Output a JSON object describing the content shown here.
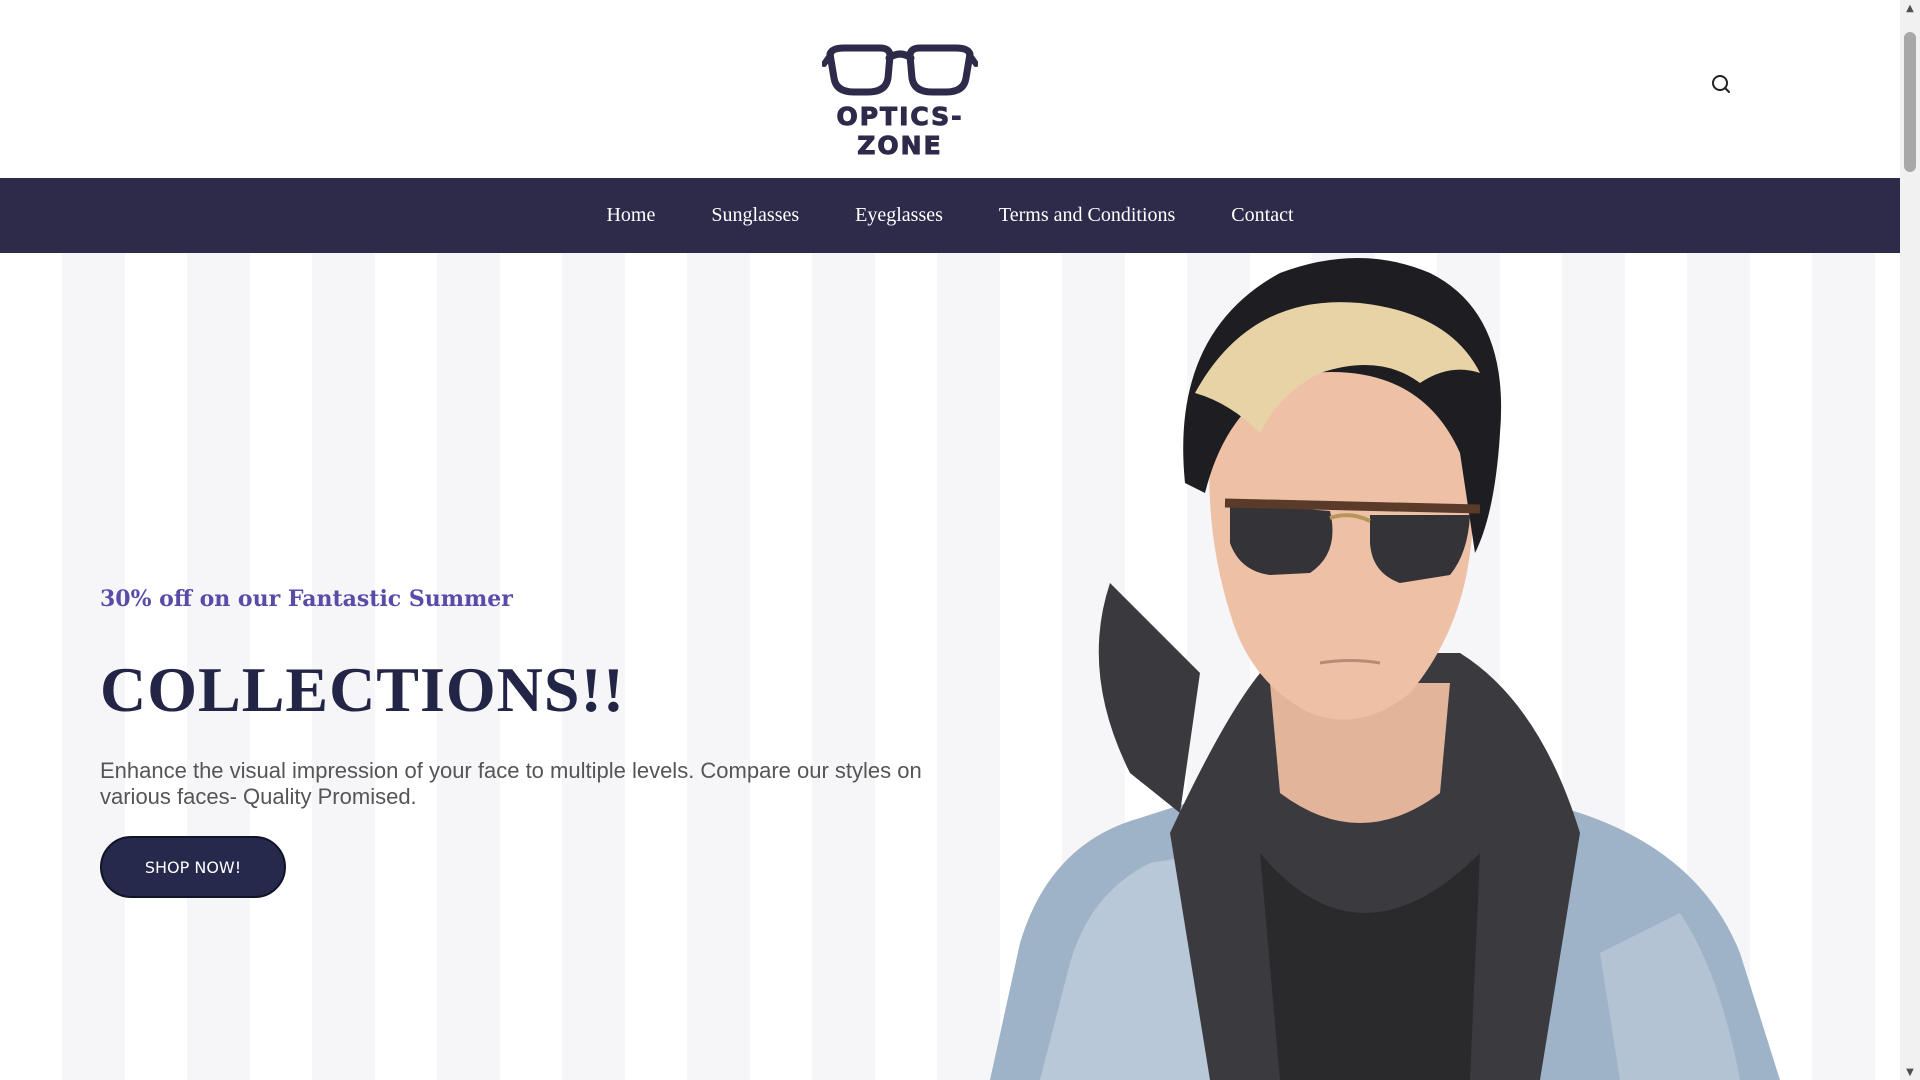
{
  "header": {
    "logo_text": "OPTICS-ZONE",
    "search_icon": "search-icon"
  },
  "nav": {
    "items": [
      {
        "label": "Home"
      },
      {
        "label": "Sunglasses"
      },
      {
        "label": "Eyeglasses"
      },
      {
        "label": "Terms and Conditions"
      },
      {
        "label": "Contact"
      }
    ]
  },
  "hero": {
    "subtitle": "30% off on our Fantastic Summer",
    "title": "COLLECTIONS!!",
    "description": "Enhance the visual impression of your face to multiple levels. Compare our styles on various faces- Quality Promised.",
    "cta_label": "SHOP NOW!",
    "image_subject": "man-wearing-sunglasses-beanie-denim-jacket"
  },
  "colors": {
    "brand_dark": "#2d2a4a",
    "accent_purple": "#5a4ba8",
    "title_navy": "#232546",
    "button_navy": "#25294b"
  },
  "scrollbar": {
    "up_arrow": "▲",
    "down_arrow": "▼"
  }
}
